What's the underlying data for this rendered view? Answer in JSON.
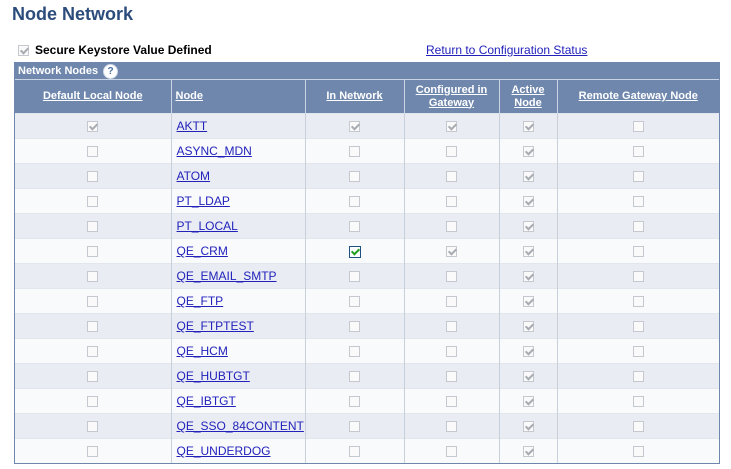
{
  "page": {
    "title": "Node Network"
  },
  "keystore": {
    "label": "Secure Keystore Value Defined",
    "checked": true
  },
  "return_link": "Return to Configuration Status",
  "grid": {
    "title": "Network Nodes",
    "help_icon": "question-circle-icon",
    "columns": [
      "Default Local Node",
      "Node",
      "In Network",
      "Configured in Gateway",
      "Active Node",
      "Remote Gateway Node"
    ],
    "rows": [
      {
        "node": "AKTT",
        "default_local": true,
        "in_network": true,
        "configured": true,
        "active": true,
        "remote": false
      },
      {
        "node": "ASYNC_MDN",
        "default_local": false,
        "in_network": false,
        "configured": false,
        "active": true,
        "remote": false
      },
      {
        "node": "ATOM",
        "default_local": false,
        "in_network": false,
        "configured": false,
        "active": true,
        "remote": false
      },
      {
        "node": "PT_LDAP",
        "default_local": false,
        "in_network": false,
        "configured": false,
        "active": true,
        "remote": false
      },
      {
        "node": "PT_LOCAL",
        "default_local": false,
        "in_network": false,
        "configured": false,
        "active": true,
        "remote": false
      },
      {
        "node": "QE_CRM",
        "default_local": false,
        "in_network": true,
        "configured": true,
        "active": true,
        "remote": false
      },
      {
        "node": "QE_EMAIL_SMTP",
        "default_local": false,
        "in_network": false,
        "configured": false,
        "active": true,
        "remote": false
      },
      {
        "node": "QE_FTP",
        "default_local": false,
        "in_network": false,
        "configured": false,
        "active": true,
        "remote": false
      },
      {
        "node": "QE_FTPTEST",
        "default_local": false,
        "in_network": false,
        "configured": false,
        "active": true,
        "remote": false
      },
      {
        "node": "QE_HCM",
        "default_local": false,
        "in_network": false,
        "configured": false,
        "active": true,
        "remote": false
      },
      {
        "node": "QE_HUBTGT",
        "default_local": false,
        "in_network": false,
        "configured": false,
        "active": true,
        "remote": false
      },
      {
        "node": "QE_IBTGT",
        "default_local": false,
        "in_network": false,
        "configured": false,
        "active": true,
        "remote": false
      },
      {
        "node": "QE_SSO_84CONTENT",
        "default_local": false,
        "in_network": false,
        "configured": false,
        "active": true,
        "remote": false
      },
      {
        "node": "QE_UNDERDOG",
        "default_local": false,
        "in_network": false,
        "configured": false,
        "active": true,
        "remote": false
      }
    ]
  },
  "colors": {
    "header_bg": "#6f87ad",
    "title": "#2c4c7c",
    "link": "#2222bb",
    "row_alt": "#e9edf3"
  }
}
